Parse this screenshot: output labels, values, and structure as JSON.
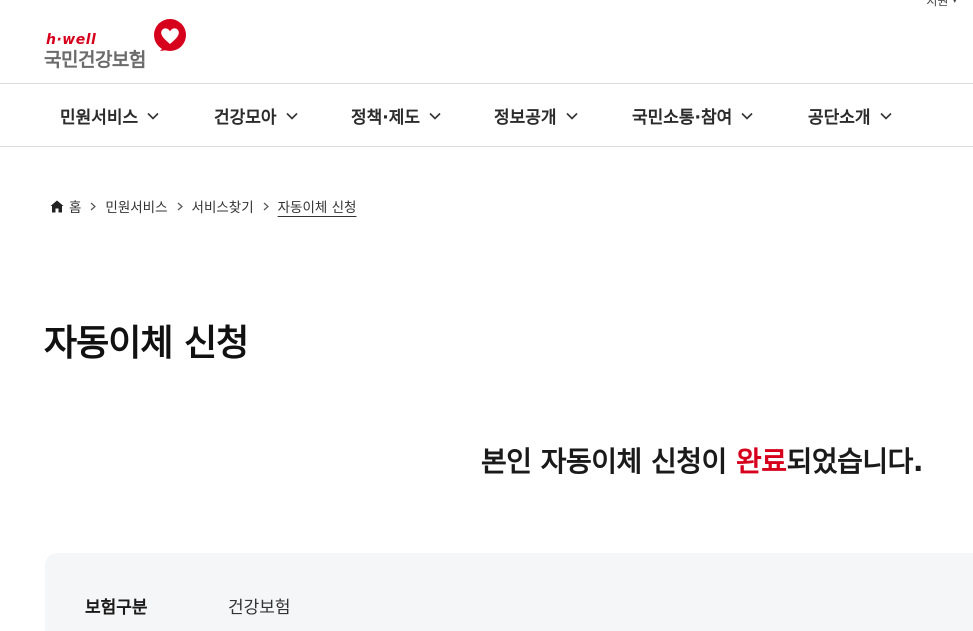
{
  "utility": {
    "label": "지원",
    "caret": "▾"
  },
  "header": {
    "logo": {
      "tagline": "h·well",
      "org_name": "국민건강보험"
    }
  },
  "gnb": {
    "items": [
      {
        "label": "민원서비스"
      },
      {
        "label": "건강모아"
      },
      {
        "label": "정책·제도"
      },
      {
        "label": "정보공개"
      },
      {
        "label": "국민소통·참여"
      },
      {
        "label": "공단소개"
      }
    ]
  },
  "breadcrumb": {
    "home": "홈",
    "items": [
      "민원서비스",
      "서비스찾기",
      "자동이체 신청"
    ]
  },
  "page": {
    "title": "자동이체 신청",
    "result": {
      "prefix": "본인 자동이체 신청이 ",
      "highlight": "완료",
      "suffix": "되었습니다."
    }
  },
  "info": {
    "rows": [
      {
        "label": "보험구분",
        "value": "건강보험"
      }
    ]
  },
  "colors": {
    "brand_red": "#d6001c",
    "panel_bg": "#f5f6f8",
    "divider": "#dcdcdc"
  },
  "icons": {
    "home": "home-icon",
    "chevron_right": "chevron-right-icon",
    "chevron_down": "chevron-down-icon",
    "logo_mark": "heart-logo-icon"
  }
}
